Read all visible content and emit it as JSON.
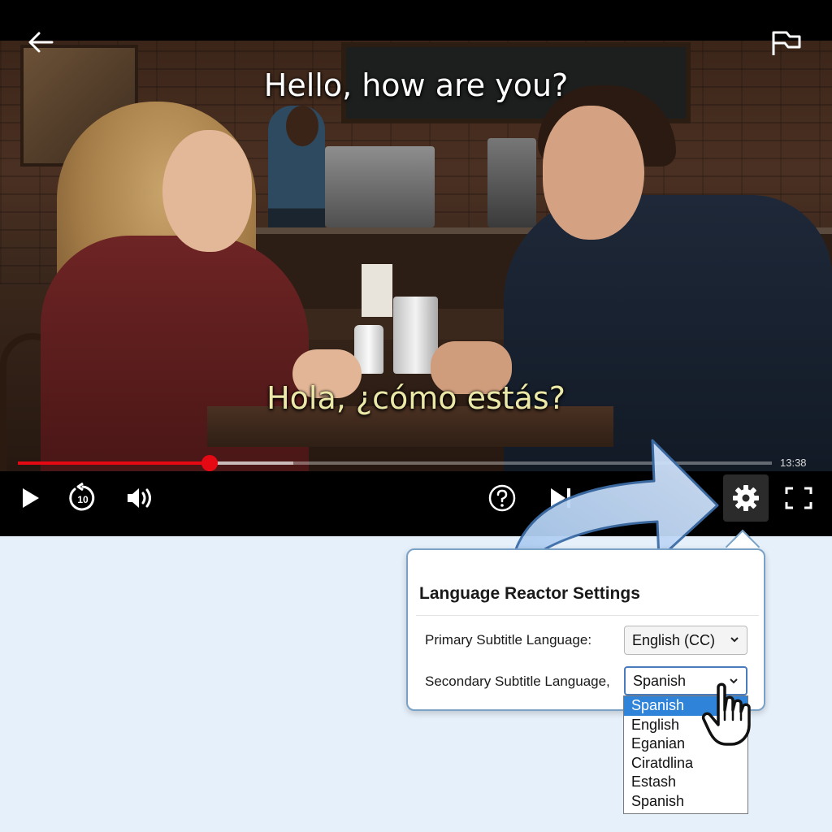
{
  "player": {
    "subtitle_primary": "Hello, how are you?",
    "subtitle_secondary": "Hola, ¿cómo estás?",
    "time_remaining": "13:38",
    "progress_fraction": 0.254,
    "buffered_fraction": 0.365,
    "accent_color": "#e50914",
    "icons": {
      "back": "back-arrow-icon",
      "flag": "flag-icon",
      "play": "play-icon",
      "rewind": "rewind-10-icon",
      "rewind_label": "10",
      "volume": "volume-icon",
      "help": "help-icon",
      "next": "next-episode-icon",
      "settings": "gear-icon",
      "fullscreen": "fullscreen-icon"
    }
  },
  "settings_panel": {
    "title": "Language Reactor Settings",
    "primary_label": "Primary Subtitle Language:",
    "primary_value": "English (CC)",
    "secondary_label": "Secondary Subtitle Language,",
    "secondary_value": "Spanish",
    "secondary_options": [
      "Spanish",
      "English",
      "Eganian",
      "Ciratdlina",
      "Estash",
      "Spanish"
    ],
    "selected_index": 0,
    "highlight_color": "#2f83d9"
  }
}
